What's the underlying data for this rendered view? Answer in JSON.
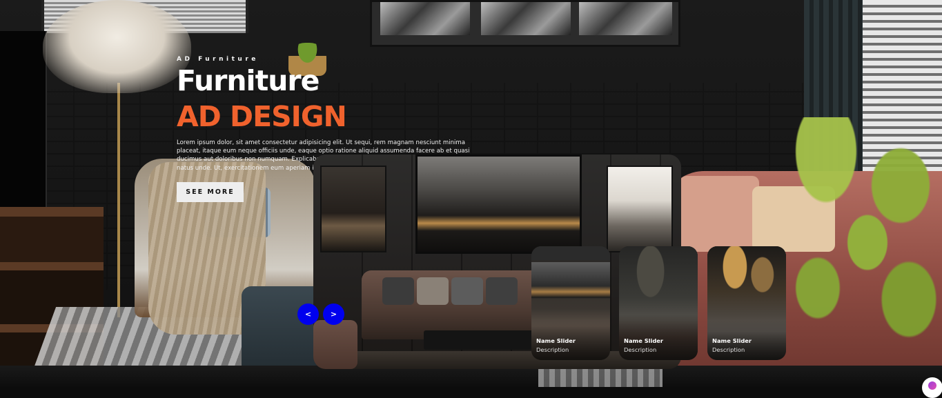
{
  "hero": {
    "tag": "AD Furniture",
    "title": "Furniture",
    "topic": "AD DESIGN",
    "description": "Lorem ipsum dolor, sit amet consectetur adipisicing elit. Ut sequi, rem magnam nesciunt minima placeat, itaque eum neque officiis unde, eaque optio ratione aliquid assumenda facere ab et quasi ducimus aut doloribus non numquam. Explicabo, laboriosam nisi reprehenderit tempora at laborum natus unde. Ut, exercitationem eum aperiam illo illum laudantium?",
    "cta_label": "SEE MORE"
  },
  "thumbnails": [
    {
      "name": "Name Slider",
      "description": "Description"
    },
    {
      "name": "Name Slider",
      "description": "Description"
    },
    {
      "name": "Name Slider",
      "description": "Description"
    }
  ],
  "arrows": {
    "prev_label": "<",
    "next_label": ">",
    "color": "#0000ee"
  },
  "colors": {
    "accent": "#f0622d",
    "title": "#ffffff",
    "cta_bg": "#eeeeee"
  },
  "icons": {
    "widget": "chat-bubble-icon"
  }
}
